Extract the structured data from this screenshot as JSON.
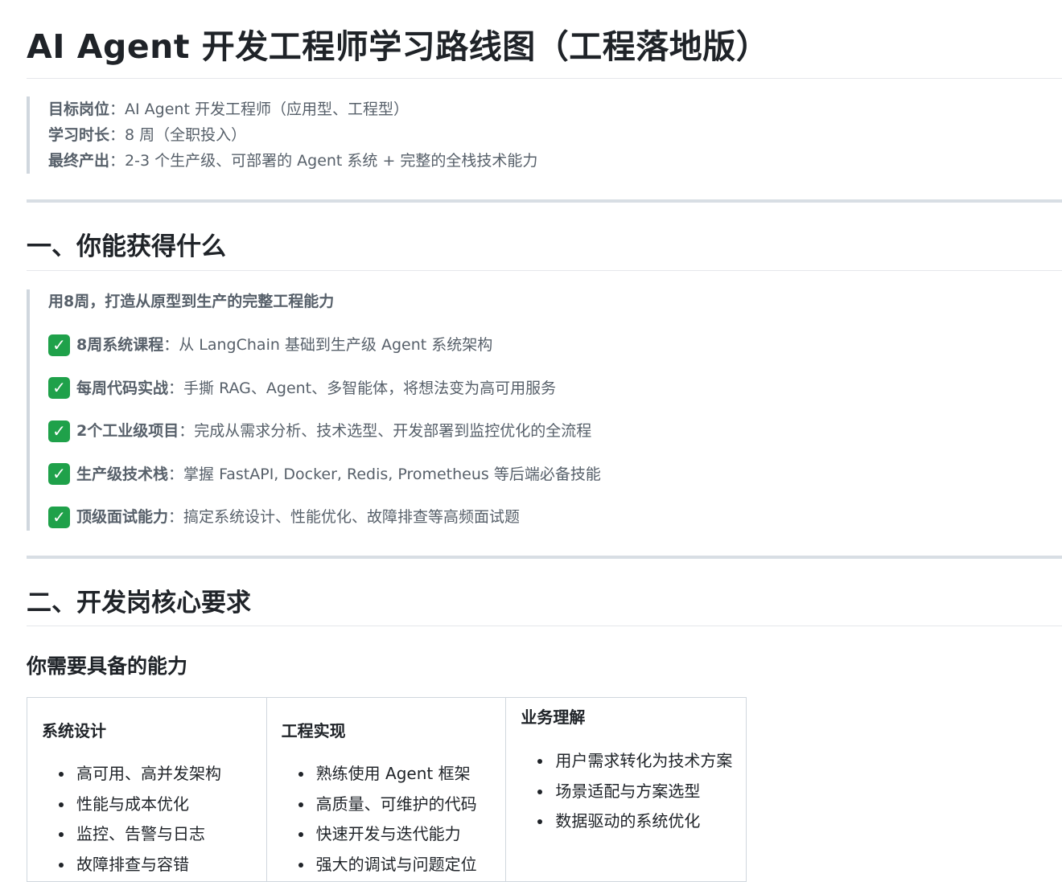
{
  "title": "AI Agent 开发工程师学习路线图（工程落地版）",
  "meta": [
    {
      "key": "目标岗位",
      "sep": "：",
      "value": "AI Agent 开发工程师（应用型、工程型）"
    },
    {
      "key": "学习时长",
      "sep": "：",
      "value": "8 周（全职投入）"
    },
    {
      "key": "最终产出",
      "sep": "：",
      "value": "2-3 个生产级、可部署的 Agent 系统 + 完整的全栈技术能力"
    }
  ],
  "section1": {
    "heading": "一、你能获得什么",
    "lead": "用8周，打造从原型到生产的完整工程能力",
    "check_glyph": "✓",
    "items": [
      {
        "key": "8周系统课程",
        "sep": "：",
        "value": "从 LangChain 基础到生产级 Agent 系统架构"
      },
      {
        "key": "每周代码实战",
        "sep": "：",
        "value": "手撕 RAG、Agent、多智能体，将想法变为高可用服务"
      },
      {
        "key": "2个工业级项目",
        "sep": "：",
        "value": "完成从需求分析、技术选型、开发部署到监控优化的全流程"
      },
      {
        "key": "生产级技术栈",
        "sep": "：",
        "value": "掌握 FastAPI, Docker, Redis, Prometheus 等后端必备技能"
      },
      {
        "key": "顶级面试能力",
        "sep": "：",
        "value": "搞定系统设计、性能优化、故障排查等高频面试题"
      }
    ]
  },
  "section2": {
    "heading": "二、开发岗核心要求",
    "subheading": "你需要具备的能力",
    "columns": [
      {
        "title": "系统设计",
        "items": [
          "高可用、高并发架构",
          "性能与成本优化",
          "监控、告警与日志",
          "故障排查与容错"
        ]
      },
      {
        "title": "工程实现",
        "items": [
          "熟练使用 Agent 框架",
          "高质量、可维护的代码",
          "快速开发与迭代能力",
          "强大的调试与问题定位"
        ]
      },
      {
        "title": "业务理解",
        "items": [
          "用户需求转化为技术方案",
          "场景适配与方案选型",
          "数据驱动的系统优化"
        ]
      }
    ]
  }
}
